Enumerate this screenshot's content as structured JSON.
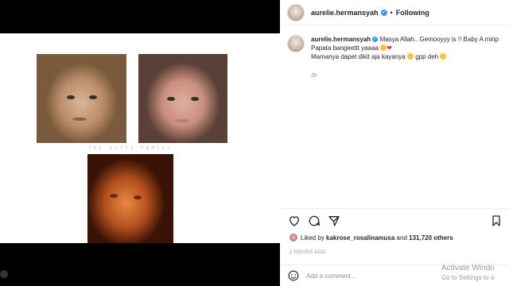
{
  "header": {
    "username": "aurelie.hermansyah",
    "separator": "•",
    "follow_state": "Following"
  },
  "caption": {
    "username": "aurelie.hermansyah",
    "line1": "Masya Allah.. Gemooyyy is !! Baby A mirip Papata bangeettt yaaaa",
    "line2": "Mamanya dapet dikit aja kayanya",
    "line2_end": "gpp deh",
    "time_ago": "2h"
  },
  "media": {
    "family_text": "THE ALIFA FAMILY"
  },
  "likes": {
    "prefix": "Liked by",
    "user": "kakrose_rosalinamusa",
    "connector": "and",
    "count": "131,720 others"
  },
  "post_date": "2 HOURS AGO",
  "comment": {
    "placeholder": "Add a comment..."
  },
  "watermark": {
    "line1": "Activate Windo",
    "line2": "Go to Settings to a"
  },
  "icons": {
    "like": "heart-icon",
    "comment": "comment-icon",
    "share": "share-icon",
    "save": "bookmark-icon",
    "emoji": "emoji-icon"
  },
  "colors": {
    "verified": "#3897f0",
    "text": "#262626",
    "muted": "#8e8e8e"
  }
}
